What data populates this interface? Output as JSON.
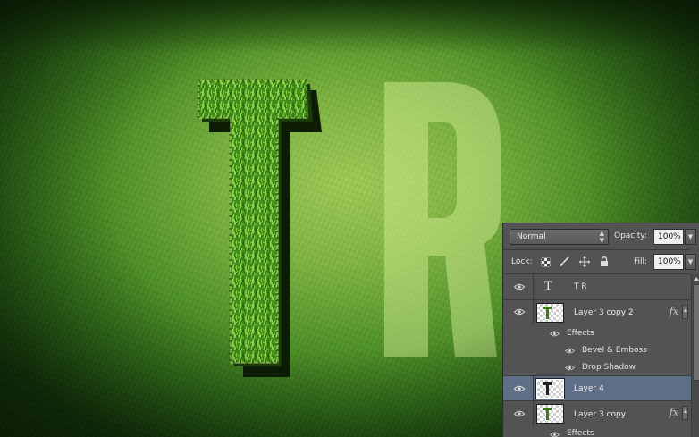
{
  "canvas": {
    "colors": {
      "background_center": "#9fcc55",
      "background_edge": "#133a08",
      "grass": "#4f9a1e",
      "ghost_letter": "#c8e88a"
    }
  },
  "layers_panel": {
    "blend_mode": "Normal",
    "opacity_label": "Opacity:",
    "opacity_value": "100%",
    "lock_label": "Lock:",
    "fill_label": "Fill:",
    "fill_value": "100%",
    "layers": [
      {
        "name": "T R",
        "type": "text",
        "icon": "type-layer-icon"
      },
      {
        "name": "Layer 3 copy 2",
        "fx": "fx",
        "effects_label": "Effects",
        "effects": [
          "Bevel & Emboss",
          "Drop Shadow"
        ]
      },
      {
        "name": "Layer 4",
        "selected": true
      },
      {
        "name": "Layer 3 copy",
        "fx": "fx",
        "effects_label": "Effects"
      }
    ],
    "colors": {
      "panel_bg": "#535353",
      "selected_row": "#5d6e86"
    }
  }
}
